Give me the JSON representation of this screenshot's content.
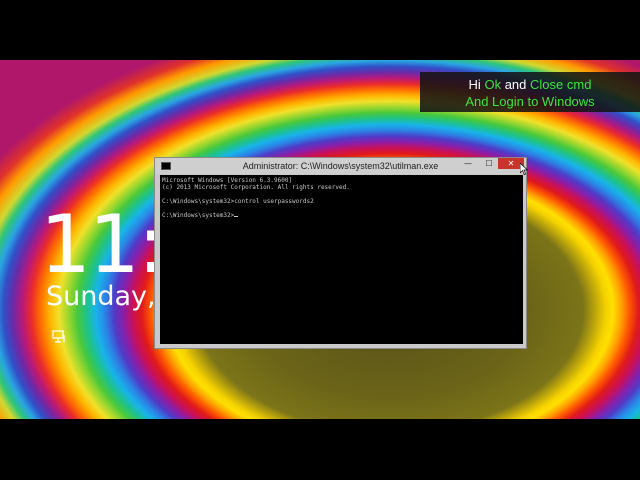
{
  "lock_screen": {
    "time": "11:4",
    "date": "Sunday, March 29",
    "ease_of_access_icon": "ease-of-access-icon"
  },
  "caption": {
    "line1": {
      "hi": "Hi",
      "ok": "Ok",
      "and": "and",
      "close": "Close cmd"
    },
    "line2": "And Login to Windows"
  },
  "cmd_window": {
    "title": "Administrator: C:\\Windows\\system32\\utilman.exe",
    "minimize_glyph": "—",
    "maximize_glyph": "☐",
    "close_glyph": "✕",
    "lines": [
      "Microsoft Windows [Version 6.3.9600]",
      "(c) 2013 Microsoft Corporation. All rights reserved.",
      "",
      "C:\\Windows\\system32>control userpasswords2",
      "",
      "C:\\Windows\\system32>"
    ]
  }
}
